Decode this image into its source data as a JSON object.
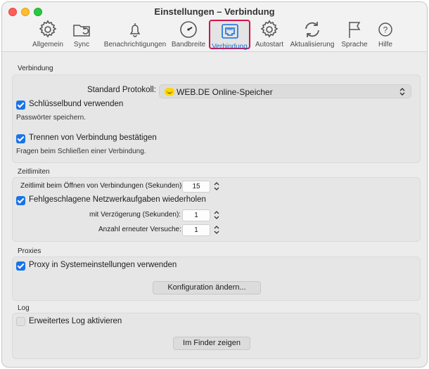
{
  "window": {
    "title": "Einstellungen – Verbindung"
  },
  "toolbar": {
    "items": [
      {
        "label": "Allgemein",
        "icon": "gear-icon"
      },
      {
        "label": "Sync",
        "icon": "sync-folder-icon"
      },
      {
        "label": "Benachrichtigungen",
        "icon": "bell-icon"
      },
      {
        "label": "Bandbreite",
        "icon": "gauge-icon"
      },
      {
        "label": "Verbindung",
        "icon": "ethernet-port-icon",
        "active": true
      },
      {
        "label": "Autostart",
        "icon": "gear-icon"
      },
      {
        "label": "Aktualisierung",
        "icon": "refresh-icon"
      },
      {
        "label": "Sprache",
        "icon": "flag-icon"
      },
      {
        "label": "Hilfe",
        "icon": "help-icon"
      }
    ]
  },
  "verbindung": {
    "section_title": "Verbindung",
    "protocol_label": "Standard Protokoll:",
    "protocol_value": "WEB.DE Online-Speicher",
    "keychain_label": "Schlüsselbund verwenden",
    "keychain_checked": true,
    "keychain_desc": "Passwörter speichern.",
    "disconnect_label": "Trennen von Verbindung bestätigen",
    "disconnect_checked": true,
    "disconnect_desc": "Fragen beim Schließen einer Verbindung."
  },
  "zeitlimiten": {
    "section_title": "Zeitlimiten",
    "timeout_label": "Zeitlimit beim Öffnen von Verbindungen (Sekunden):",
    "timeout_value": "15",
    "retry_label": "Fehlgeschlagene Netzwerkaufgaben wiederholen",
    "retry_checked": true,
    "delay_label": "mit Verzögerung (Sekunden):",
    "delay_value": "1",
    "attempts_label": "Anzahl erneuter Versuche:",
    "attempts_value": "1"
  },
  "proxies": {
    "section_title": "Proxies",
    "system_proxy_label": "Proxy in Systemeinstellungen verwenden",
    "system_proxy_checked": true,
    "config_button": "Konfiguration ändern..."
  },
  "log": {
    "section_title": "Log",
    "extended_label": "Erweitertes Log aktivieren",
    "extended_checked": false,
    "finder_button": "Im Finder zeigen"
  },
  "colors": {
    "accent": "#1a73e8",
    "active_highlight": "#d1144b",
    "active_label": "#1470d8"
  }
}
